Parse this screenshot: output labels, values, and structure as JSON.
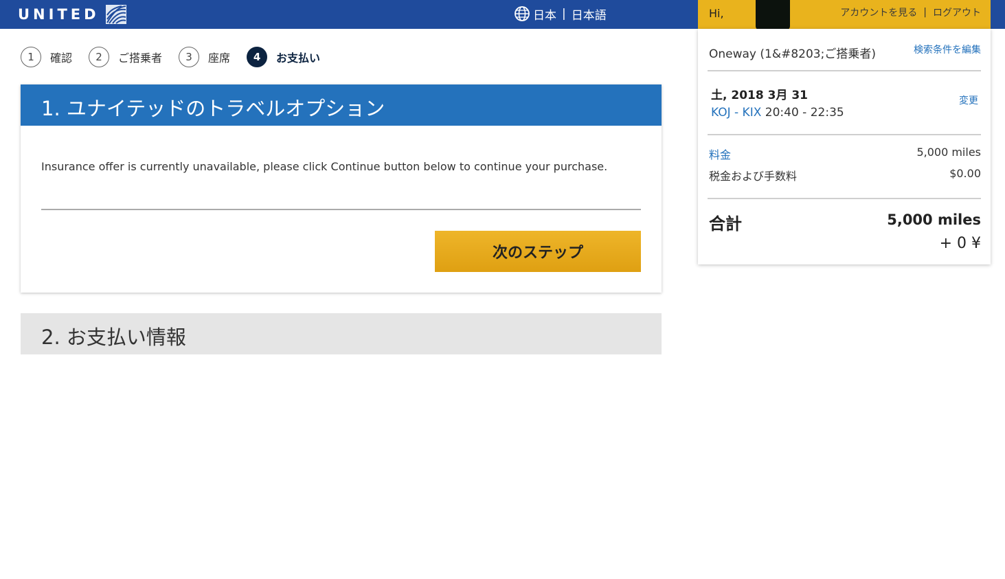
{
  "header": {
    "brand": "UNITED",
    "language": {
      "region": "日本",
      "language": "日本語"
    },
    "account": {
      "greeting": "Hi,",
      "view_account": "アカウントを見る",
      "logout": "ログアウト"
    }
  },
  "steps": [
    {
      "num": "1",
      "label": "確認"
    },
    {
      "num": "2",
      "label": "ご搭乗者"
    },
    {
      "num": "3",
      "label": "座席"
    },
    {
      "num": "4",
      "label": "お支払い"
    }
  ],
  "section1": {
    "title": "1. ユナイテッドのトラベルオプション",
    "message": "Insurance offer is currently unavailable, please click Continue button below to continue your purchase.",
    "next_button": "次のステップ"
  },
  "section2": {
    "title": "2. お支払い情報"
  },
  "summary": {
    "trip": "Oneway (1&#8203;ご搭乗者)",
    "edit_search": "検索条件を編集",
    "date": "土, 2018 3月 31",
    "change": "変更",
    "route_codes": "KOJ - KIX",
    "route_times": "20:40 - 22:35",
    "fare_label": "料金",
    "fare_value": "5,000 miles",
    "tax_label": "税金および手数料",
    "tax_value": "$0.00",
    "total_label": "合計",
    "total_miles": "5,000 miles",
    "total_yen": "+ 0 ¥"
  },
  "colors": {
    "topbar": "#1f4b9c",
    "account_bar": "#e9b31d",
    "section_header": "#2472bc",
    "active_step": "#0c2340",
    "button": "#e5a91d",
    "link": "#2472bc"
  }
}
